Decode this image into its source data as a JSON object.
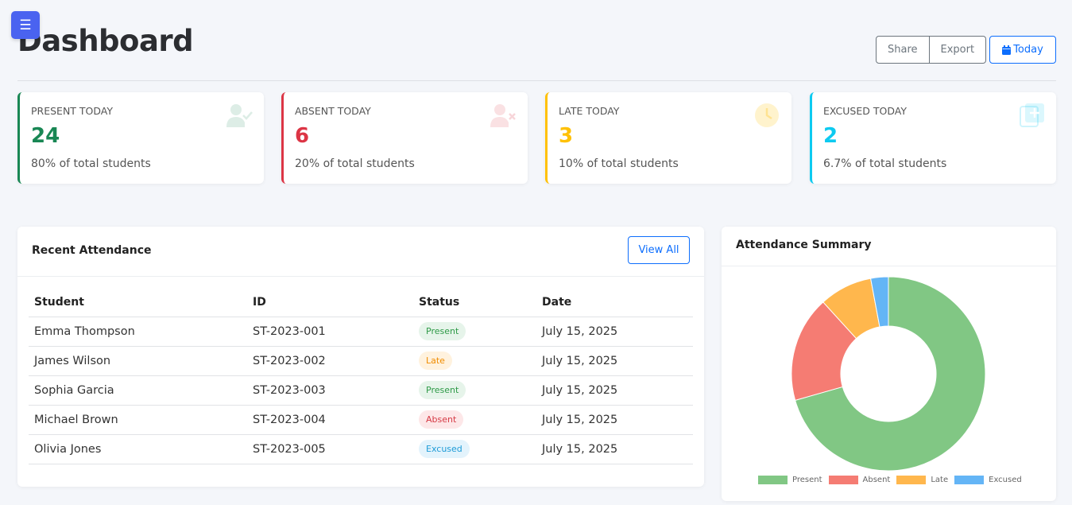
{
  "header": {
    "title": "Dashboard",
    "share_label": "Share",
    "export_label": "Export",
    "today_label": "Today"
  },
  "stats": [
    {
      "label": "PRESENT TODAY",
      "value": "24",
      "sub": "80% of total students",
      "color": "#198754",
      "icon": "user-check-icon"
    },
    {
      "label": "ABSENT TODAY",
      "value": "6",
      "sub": "20% of total students",
      "color": "#dc3545",
      "icon": "user-times-icon"
    },
    {
      "label": "LATE TODAY",
      "value": "3",
      "sub": "10% of total students",
      "color": "#ffc107",
      "icon": "clock-icon"
    },
    {
      "label": "EXCUSED TODAY",
      "value": "2",
      "sub": "6.7% of total students",
      "color": "#0dcaf0",
      "icon": "clipboard-plus-icon"
    }
  ],
  "attendance": {
    "title": "Recent Attendance",
    "view_all_label": "View All",
    "columns": [
      "Student",
      "ID",
      "Status",
      "Date"
    ],
    "rows": [
      {
        "student": "Emma Thompson",
        "id": "ST-2023-001",
        "status": "Present",
        "date": "July 15, 2025"
      },
      {
        "student": "James Wilson",
        "id": "ST-2023-002",
        "status": "Late",
        "date": "July 15, 2025"
      },
      {
        "student": "Sophia Garcia",
        "id": "ST-2023-003",
        "status": "Present",
        "date": "July 15, 2025"
      },
      {
        "student": "Michael Brown",
        "id": "ST-2023-004",
        "status": "Absent",
        "date": "July 15, 2025"
      },
      {
        "student": "Olivia Jones",
        "id": "ST-2023-005",
        "status": "Excused",
        "date": "July 15, 2025"
      }
    ]
  },
  "summary": {
    "title": "Attendance Summary"
  },
  "chart_data": {
    "type": "pie",
    "categories": [
      "Present",
      "Absent",
      "Late",
      "Excused"
    ],
    "values": [
      24,
      6,
      3,
      1
    ],
    "colors": [
      "#81c784",
      "#f57c73",
      "#ffb74d",
      "#64b5f6"
    ],
    "legend": "bottom"
  }
}
